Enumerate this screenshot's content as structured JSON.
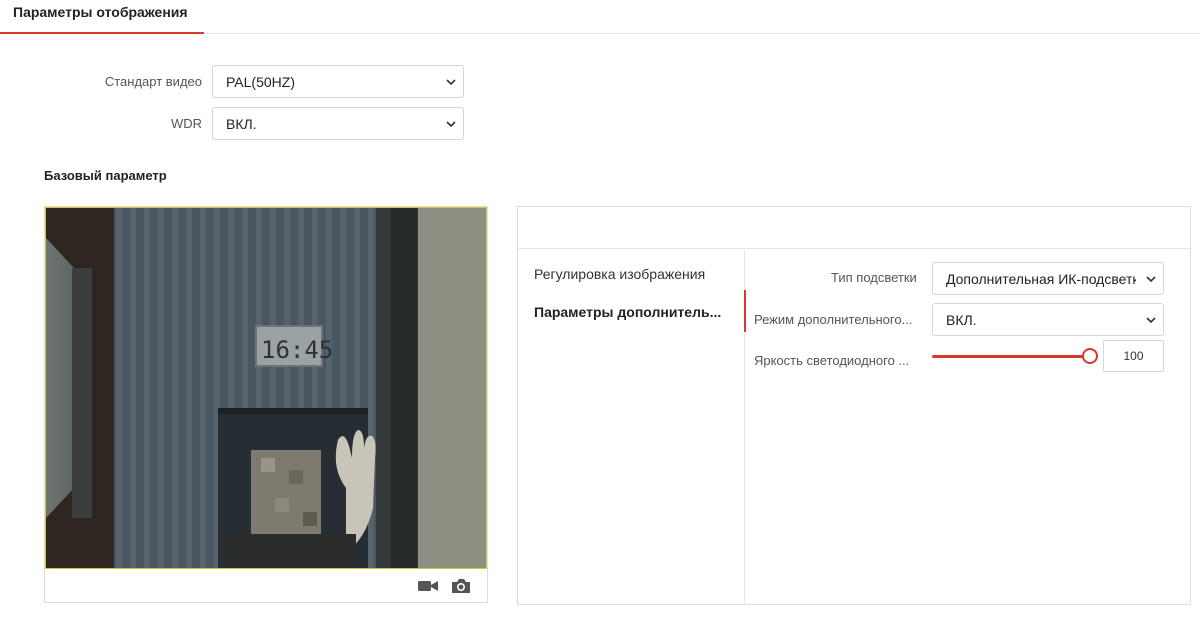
{
  "tabs": {
    "active_label": "Параметры отображения"
  },
  "video_standard": {
    "label": "Стандарт видео",
    "value": "PAL(50HZ)"
  },
  "wdr": {
    "label": "WDR",
    "value": "ВКЛ."
  },
  "section": {
    "title": "Базовый параметр"
  },
  "preview": {
    "clock_text": "16:45",
    "toolbar": {
      "record_icon": "video-camera-icon",
      "snapshot_icon": "camera-icon"
    }
  },
  "panel": {
    "nav": {
      "items": [
        {
          "label": "Регулировка изображения",
          "active": false
        },
        {
          "label": "Параметры дополнитель...",
          "active": true
        }
      ]
    },
    "fields": {
      "light_type": {
        "label": "Тип подсветки",
        "value": "Дополнительная ИК-подсветка"
      },
      "light_mode": {
        "label": "Режим дополнительного...",
        "value": "ВКЛ."
      },
      "led_brightness": {
        "label": "Яркость светодиодного ...",
        "value": "100"
      }
    }
  },
  "colors": {
    "accent": "#d9382b",
    "preview_border": "#d8c63a"
  }
}
